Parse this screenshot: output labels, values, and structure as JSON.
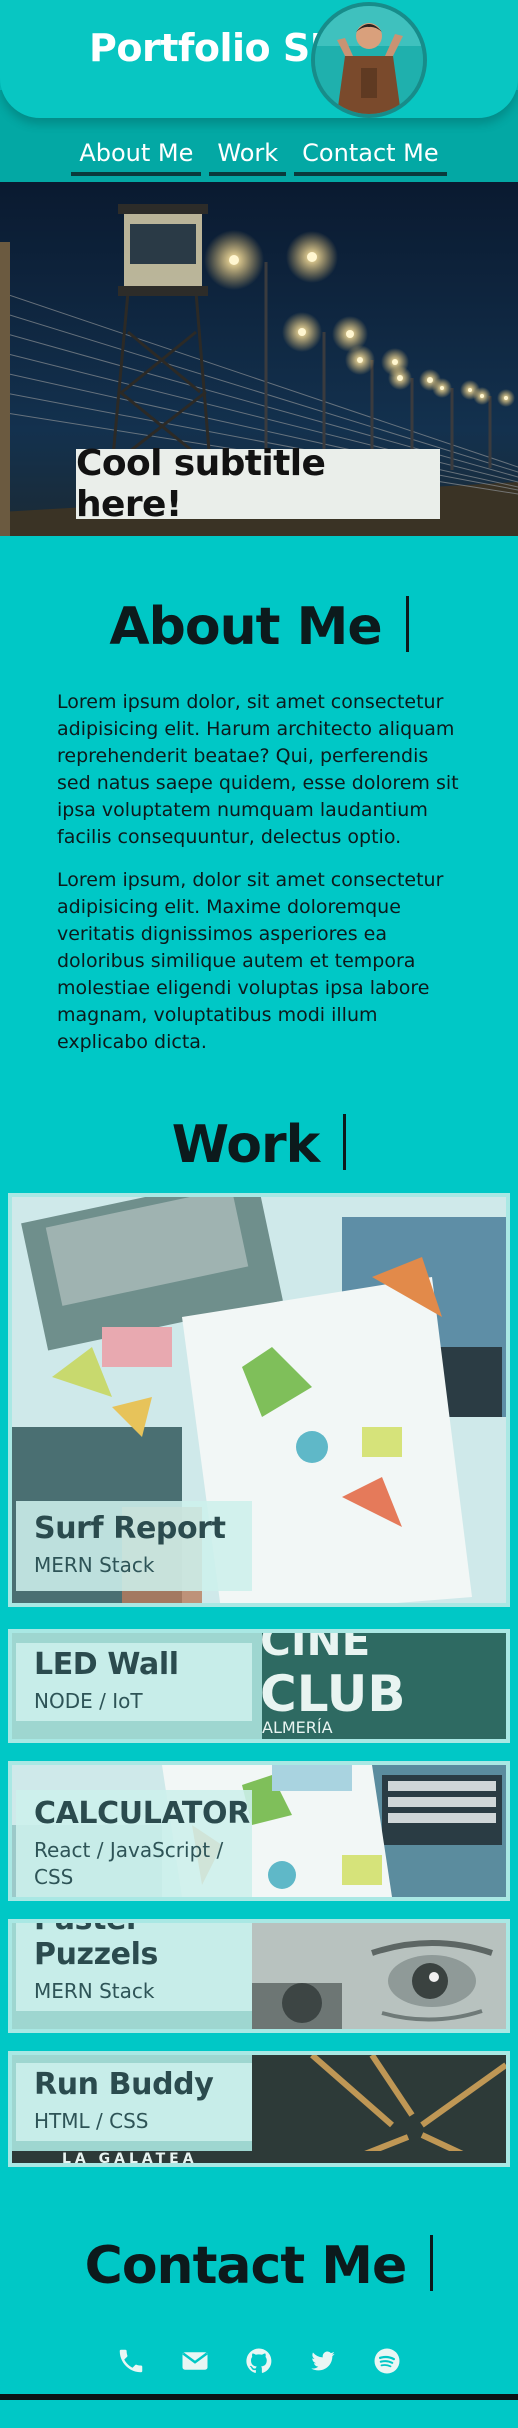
{
  "header": {
    "brand": "Portfolio SU",
    "avatar_icon": "person-avatar"
  },
  "nav": {
    "items": [
      {
        "label": "About Me"
      },
      {
        "label": "Work"
      },
      {
        "label": "Contact Me"
      }
    ]
  },
  "hero": {
    "subtitle": "Cool subtitle here!"
  },
  "about": {
    "title": "About Me",
    "paragraphs": [
      "Lorem ipsum dolor, sit amet consectetur adipisicing elit. Harum architecto aliquam reprehenderit beatae? Qui, perferendis sed natus saepe quidem, esse dolorem sit ipsa voluptatem numquam laudantium facilis consequuntur, delectus optio.",
      "Lorem ipsum, dolor sit amet consectetur adipisicing elit. Maxime doloremque veritatis dignissimos asperiores ea doloribus similique autem et tempora molestiae eligendi voluptas ipsa labore magnam, voluptatibus modi illum explicabo dicta."
    ]
  },
  "work": {
    "title": "Work",
    "projects": [
      {
        "title": "Surf Report",
        "stack": "MERN Stack"
      },
      {
        "title": "LED Wall",
        "stack": "NODE / IoT",
        "image_text": [
          "CINE",
          "CLUB",
          "ALMERÍA"
        ]
      },
      {
        "title": "CALCULATOR",
        "stack": "React / JavaScript / CSS"
      },
      {
        "title": "Pastel Puzzels",
        "stack": "MERN Stack"
      },
      {
        "title": "Run Buddy",
        "stack": "HTML / CSS",
        "image_text": "LA GALATEA"
      }
    ]
  },
  "contact": {
    "title": "Contact Me",
    "icons": [
      "phone-icon",
      "mail-icon",
      "github-icon",
      "twitter-icon",
      "spotify-icon"
    ]
  },
  "colors": {
    "background": "#00c8c6",
    "nav_band": "#03a8a4",
    "card_frame": "#a9e8e4",
    "text_dark": "#0c1a1c"
  }
}
